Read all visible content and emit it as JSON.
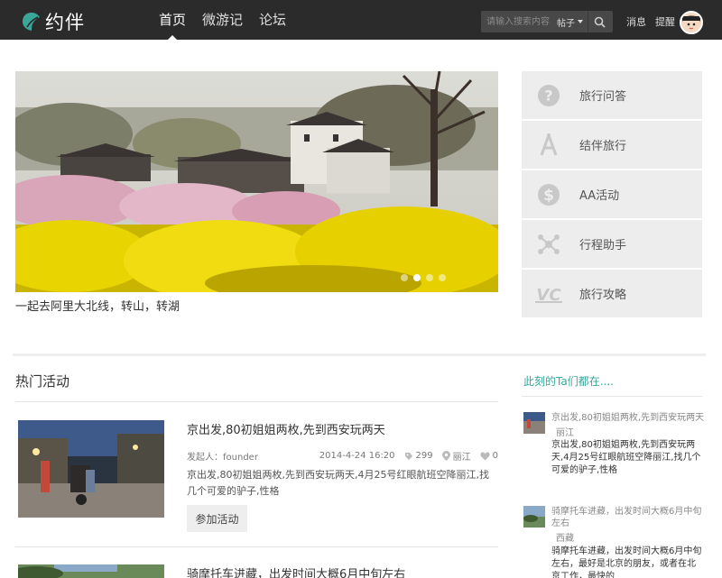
{
  "brand": {
    "name": "约伴",
    "accent": "#3aa79a"
  },
  "nav": {
    "items": [
      "首页",
      "微游记",
      "论坛"
    ],
    "active": 0
  },
  "search": {
    "placeholder": "请输入搜索内容",
    "scope": "帖子",
    "icon": "search-icon"
  },
  "top_links": {
    "messages": "消息",
    "reminders": "提醒"
  },
  "hero": {
    "caption": "一起去阿里大北线，转山，转湖",
    "slide_count": 4,
    "active_slide": 1
  },
  "side_menu": [
    {
      "icon": "question-icon",
      "label": "旅行问答"
    },
    {
      "icon": "compass-icon",
      "label": "结伴旅行"
    },
    {
      "icon": "dollar-icon",
      "label": "AA活动"
    },
    {
      "icon": "network-icon",
      "label": "行程助手"
    },
    {
      "icon": "vc-icon",
      "label": "旅行攻略"
    }
  ],
  "hot": {
    "title": "热门活动",
    "activities": [
      {
        "title": "京出发,80初姐姐两枚,先到西安玩两天",
        "initiator": "发起人：founder",
        "date": "2014-4-24 16:20",
        "views": "299",
        "location": "丽江",
        "likes": "0",
        "desc": "京出发,80初姐姐两枚,先到西安玩两天,4月25号红眼航班空降丽江,找几个可爱的驴子,性格",
        "button": "参加活动"
      },
      {
        "title": "骑摩托车进藏，出发时间大概6月中旬左右"
      }
    ]
  },
  "now": {
    "title": "此刻的Ta们都在....",
    "people": [
      {
        "title": "京出发,80初姐姐两枚,先到西安玩两天",
        "location": "丽江",
        "desc": "京出发,80初姐姐两枚,先到西安玩两天,4月25号红眼航班空降丽江,找几个可爱的驴子,性格"
      },
      {
        "title": "骑摩托车进藏，出发时间大概6月中旬左右",
        "location": "西藏",
        "desc": "骑摩托车进藏，出发时间大概6月中旬左右，最好是北京的朋友，或者在北京工作，最快的"
      }
    ]
  }
}
